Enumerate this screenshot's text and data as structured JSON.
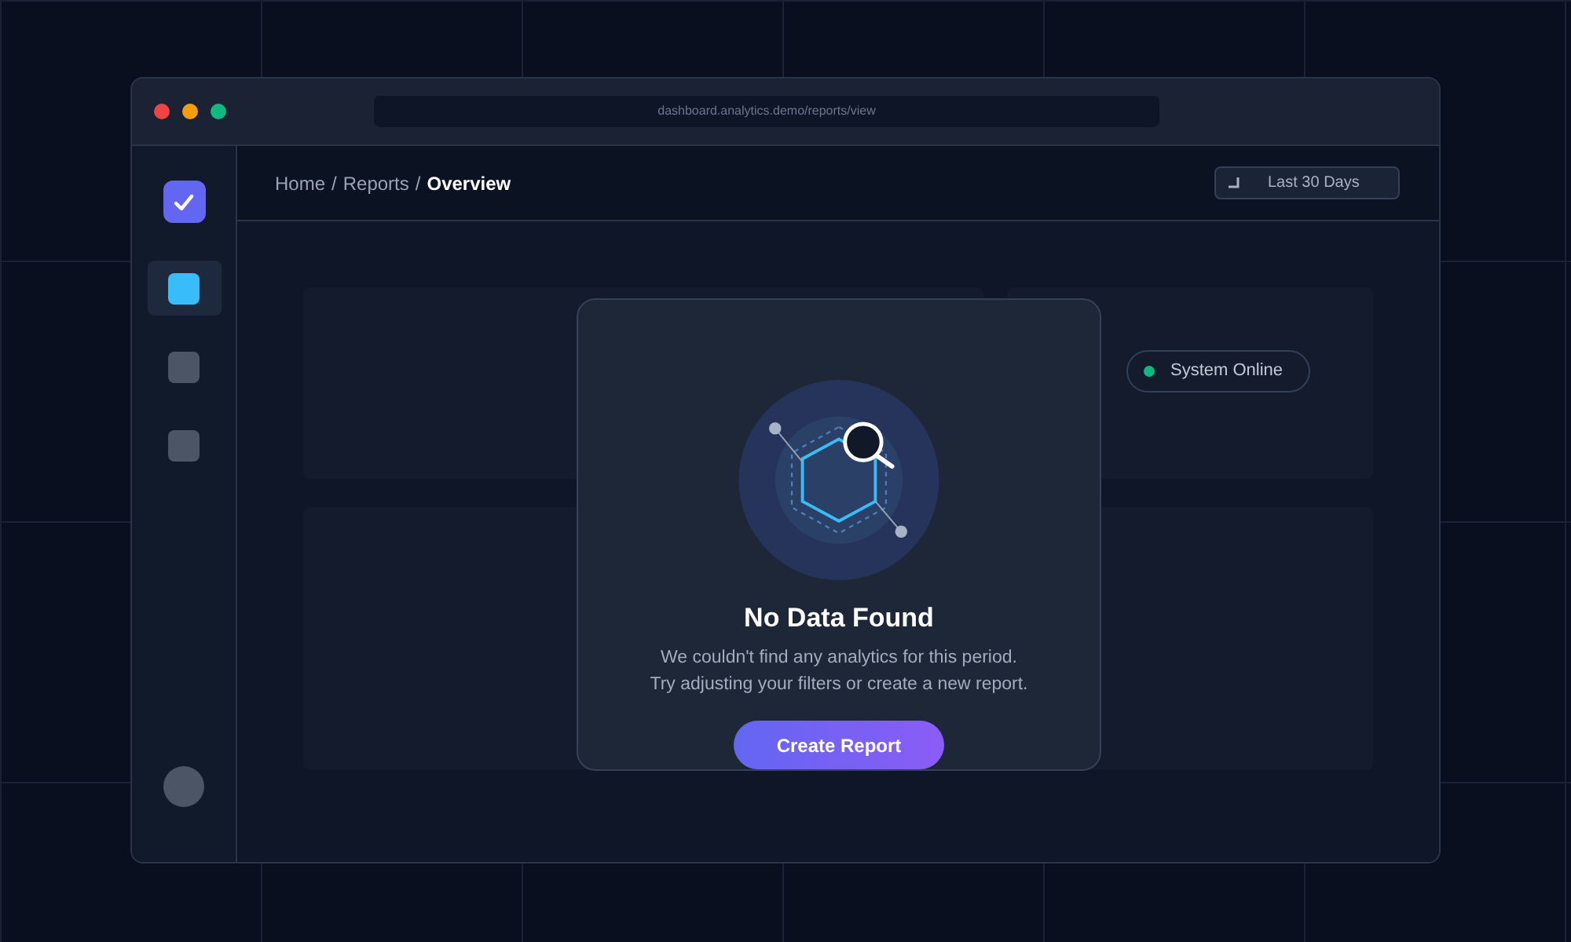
{
  "window": {
    "url": "dashboard.analytics.demo/reports/view"
  },
  "sidebar": {
    "items": [
      {
        "selected": true
      },
      {
        "selected": false
      },
      {
        "selected": false
      }
    ]
  },
  "breadcrumb": {
    "items": [
      "Home",
      "Reports"
    ],
    "current": "Overview",
    "separator": "/"
  },
  "date_range": {
    "label": "Last 30 Days"
  },
  "status": {
    "label": "System Online",
    "color": "#10b981"
  },
  "empty_state": {
    "title": "No Data Found",
    "message_lines": [
      "We couldn't find any analytics for this period.",
      "Try adjusting your filters or create a new report."
    ],
    "button": "Create Report"
  }
}
